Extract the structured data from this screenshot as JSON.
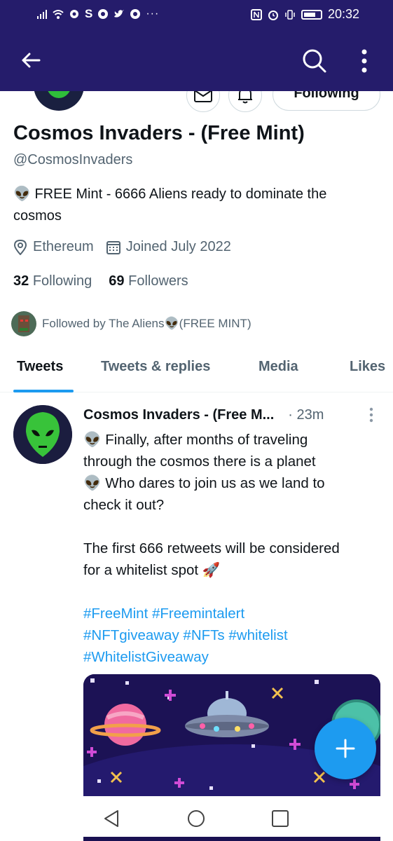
{
  "status_bar": {
    "time": "20:32",
    "overflow": "···"
  },
  "profile": {
    "name": "Cosmos Invaders - (Free Mint)",
    "handle": "@CosmosInvaders",
    "bio_line1": "👽 FREE Mint - 6666 Aliens ready to dominate the",
    "bio_line2": "cosmos",
    "location": "Ethereum",
    "joined": "Joined July 2022",
    "following_count": "32",
    "following_label": "Following",
    "followers_count": "69",
    "followers_label": "Followers",
    "followed_by": "Followed by The Aliens👽(FREE MINT)",
    "follow_button": "Following"
  },
  "tabs": [
    {
      "label": "Tweets"
    },
    {
      "label": "Tweets & replies"
    },
    {
      "label": "Media"
    },
    {
      "label": "Likes"
    }
  ],
  "tweet": {
    "author": "Cosmos Invaders - (Free M...",
    "time": "· 23m",
    "lines": [
      "👽 Finally, after months of traveling",
      "through the cosmos there is a planet",
      "👽 Who dares to join us as we land to",
      "check it out?",
      "The first 666 retweets will be considered",
      "for a whitelist spot 🚀"
    ],
    "hashtags_line1": [
      "#FreeMint",
      "#Freemintalert"
    ],
    "hashtags_line2": [
      "#NFTgiveaway",
      "#NFTs",
      "#whitelist"
    ],
    "hashtags_line3": [
      "#WhitelistGiveaway"
    ]
  },
  "colors": {
    "app_bar": "#251c6b",
    "accent": "#1d9bf0",
    "secondary_text": "#536471"
  },
  "icons": [
    "back-arrow-icon",
    "search-icon",
    "more-vertical-icon",
    "mail-icon",
    "bell-icon",
    "location-pin-icon",
    "calendar-icon",
    "compose-plus-icon",
    "nav-back-icon",
    "nav-home-icon",
    "nav-recents-icon"
  ]
}
